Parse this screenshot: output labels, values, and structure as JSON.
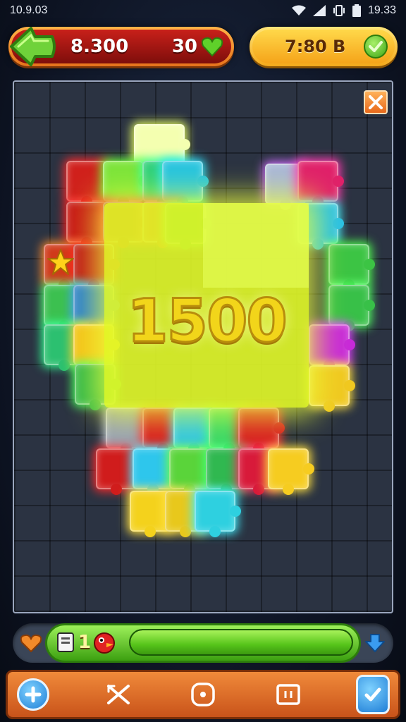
{
  "status_bar": {
    "time_left": "10.9.03",
    "time_right": "19.33",
    "icons": [
      "wifi-icon",
      "signal-icon",
      "vibrate-icon",
      "battery-icon"
    ]
  },
  "hud": {
    "score": "8.300",
    "lives": "30",
    "timer": "7:80 B"
  },
  "board": {
    "big_score": "1500"
  },
  "progress": {
    "counter": "1",
    "fill_fraction": 1.0
  },
  "toolbar": {
    "icons": [
      "plus-icon",
      "shuffle-icon",
      "target-icon",
      "pause-icon",
      "hint-icon"
    ]
  },
  "colors": {
    "hud_red": "#a8160f",
    "hud_gold": "#f5b021",
    "board_bg": "#2b3342",
    "highlight": "#e2fa28",
    "progress_green": "#56c41a",
    "toolbar_orange": "#e0732c"
  }
}
